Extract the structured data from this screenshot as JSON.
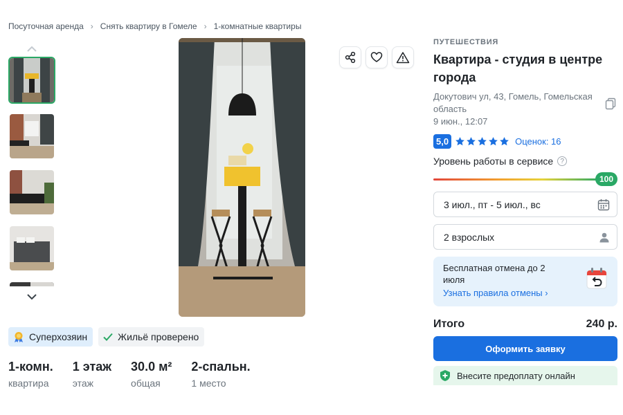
{
  "breadcrumb": {
    "items": [
      "Посуточная аренда",
      "Снять квартиру в Гомеле",
      "1-комнатные квартиры"
    ],
    "separator": "›"
  },
  "gallery": {
    "thumbnail_count_visible": 5,
    "active_index": 0
  },
  "badges": {
    "superhost": "Суперхозяин",
    "verified": "Жильё проверено"
  },
  "specs": [
    {
      "value": "1-комн.",
      "label": "квартира"
    },
    {
      "value": "1 этаж",
      "label": "этаж"
    },
    {
      "value": "30.0 м²",
      "label": "общая"
    },
    {
      "value": "2-спальн.",
      "label": "1 место"
    }
  ],
  "listing": {
    "category": "ПУТЕШЕСТВИЯ",
    "title": "Квартира - студия в центре города",
    "address": "Докутович ул, 43, Гомель, Гомельская область",
    "date": "9 июн., 12:07",
    "rating_score": "5,0",
    "stars": 5,
    "reviews": "Оценок: 16",
    "service_label": "Уровень работы в сервисе",
    "service_help": "?",
    "service_value": "100"
  },
  "booking": {
    "dates": "3 июл., пт - 5 июл., вс",
    "guests": "2 взрослых",
    "cancel_text": "Бесплатная отмена до 2 июля",
    "cancel_link": "Узнать правила отмены ›",
    "total_label": "Итого",
    "total_value": "240 р.",
    "submit_label": "Оформить заявку",
    "prepay_text": "Внесите предоплату онлайн"
  },
  "colors": {
    "accent": "#1a6fe0",
    "success": "#2aa865",
    "star": "#1a6fe0"
  }
}
